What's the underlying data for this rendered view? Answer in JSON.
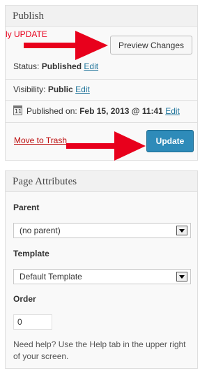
{
  "publish": {
    "title": "Publish",
    "annotation": "ly UPDATE",
    "preview_label": "Preview Changes",
    "status_label": "Status:",
    "status_value": "Published",
    "status_edit": "Edit",
    "visibility_label": "Visibility:",
    "visibility_value": "Public",
    "visibility_edit": "Edit",
    "calendar_icon_text": "11",
    "published_label": "Published on:",
    "published_value": "Feb 15, 2013 @ 11:41",
    "published_edit": "Edit",
    "trash_label": "Move to Trash",
    "update_label": "Update"
  },
  "attributes": {
    "title": "Page Attributes",
    "parent_label": "Parent",
    "parent_value": "(no parent)",
    "template_label": "Template",
    "template_value": "Default Template",
    "order_label": "Order",
    "order_value": "0",
    "help_text": "Need help? Use the Help tab in the upper right of your screen."
  },
  "colors": {
    "arrow": "#e8001c",
    "update_button": "#2e8bb9",
    "link": "#21759b",
    "trash": "#bc0b0b"
  },
  "icons": [
    "calendar-icon",
    "chevron-down-icon",
    "red-arrow"
  ]
}
